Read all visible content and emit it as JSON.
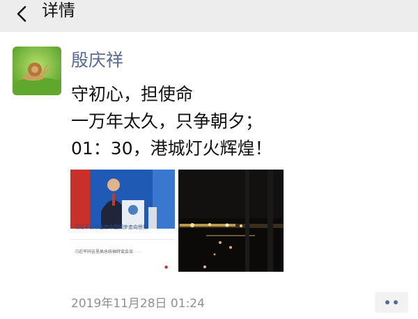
{
  "nav": {
    "title": "详情",
    "back_icon": "chevron-left-icon"
  },
  "moment": {
    "author": "殷庆祥",
    "text_lines": [
      "守初心，担使命",
      "一万年太久，只争朝夕；",
      "01：30，港城灯火辉煌！"
    ],
    "images": [
      {
        "caption": "习近平引领自信中国同步走向世界",
        "subcaption": "习近平同吉里高总统抽特诞会谈"
      },
      {}
    ],
    "timestamp": "2019年11月28日 01:24",
    "more_icon": "more-dots-icon"
  },
  "colors": {
    "nav_bg": "#ededed",
    "author": "#576b95",
    "timestamp": "#8f8f8f"
  }
}
